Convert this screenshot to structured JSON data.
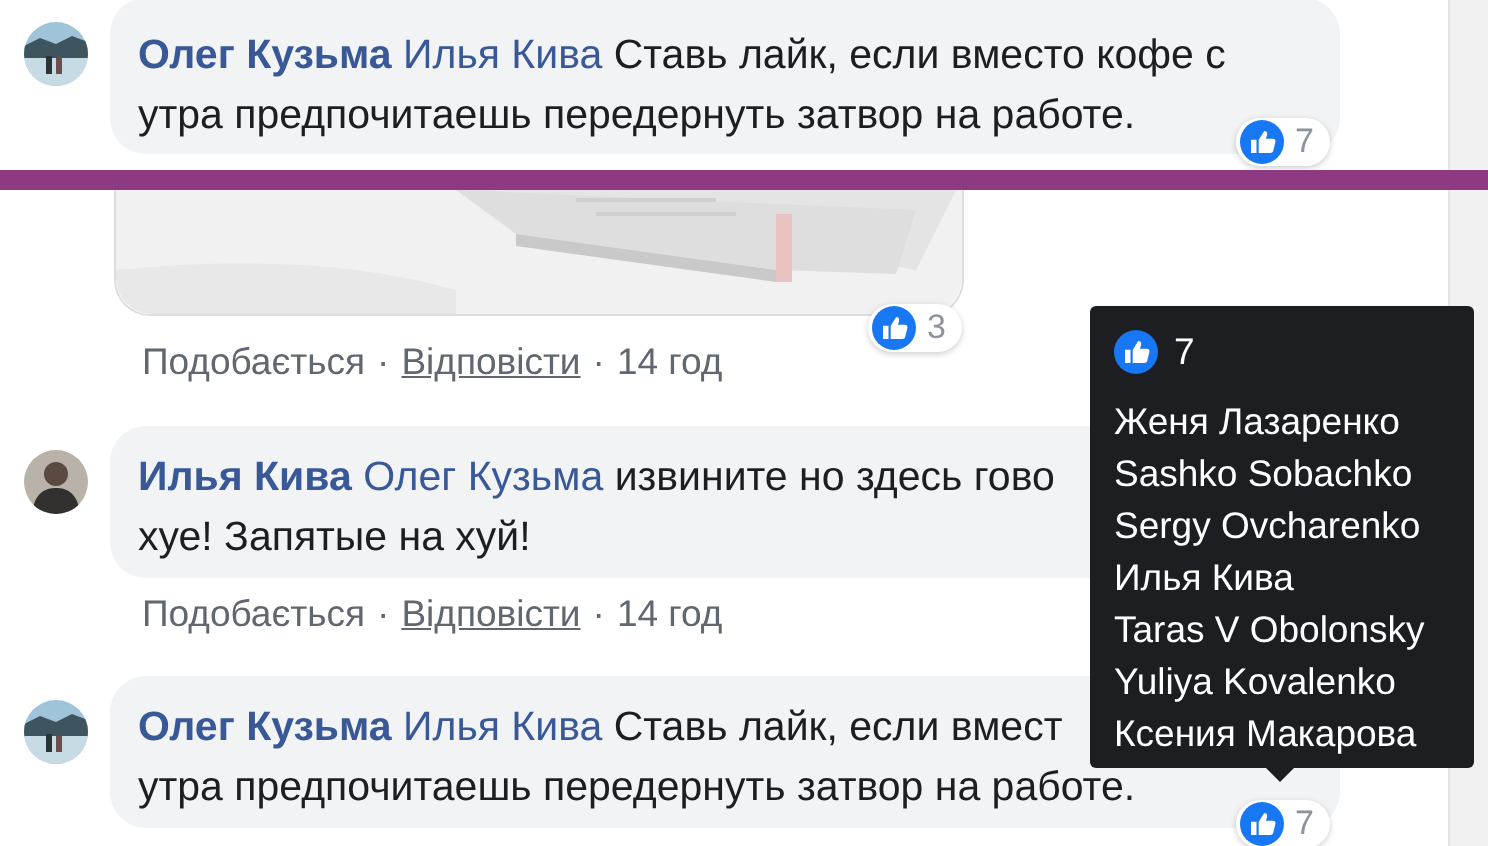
{
  "items": [
    {
      "kind": "comment",
      "author": "Олег Кузьма",
      "mention": "Илья Кива",
      "lines": [
        "Ставь лайк, если вместо кофе с",
        "утра предпочитаешь передернуть затвор на работе."
      ],
      "reactions": "7"
    },
    {
      "kind": "attachment",
      "reactions": "3"
    },
    {
      "kind": "actions",
      "like": "Подобається",
      "sep": "·",
      "reply": "Відповісти",
      "time": "14 год"
    },
    {
      "kind": "comment",
      "author": "Илья Кива",
      "mention": "Олег Кузьма",
      "lines": [
        "извините но здесь гово",
        "хуе! Запятые на хуй!"
      ]
    },
    {
      "kind": "actions",
      "like": "Подобається",
      "sep": "·",
      "reply": "Відповісти",
      "time": "14 год"
    },
    {
      "kind": "comment",
      "author": "Олег Кузьма",
      "mention": "Илья Кива",
      "lines": [
        "Ставь лайк, если вмест",
        "утра предпочитаешь передернуть затвор на работе."
      ],
      "reactions": "7"
    }
  ],
  "band": {
    "color": "#8e3a82"
  },
  "tooltip": {
    "count": "7",
    "names": [
      "Женя Лазаренко",
      "Sashko Sobachko",
      "Sergy Ovcharenko",
      "Илья Кива",
      "Taras V Obolonsky",
      "Yuliya Kovalenko",
      "Ксения Макарова"
    ]
  }
}
